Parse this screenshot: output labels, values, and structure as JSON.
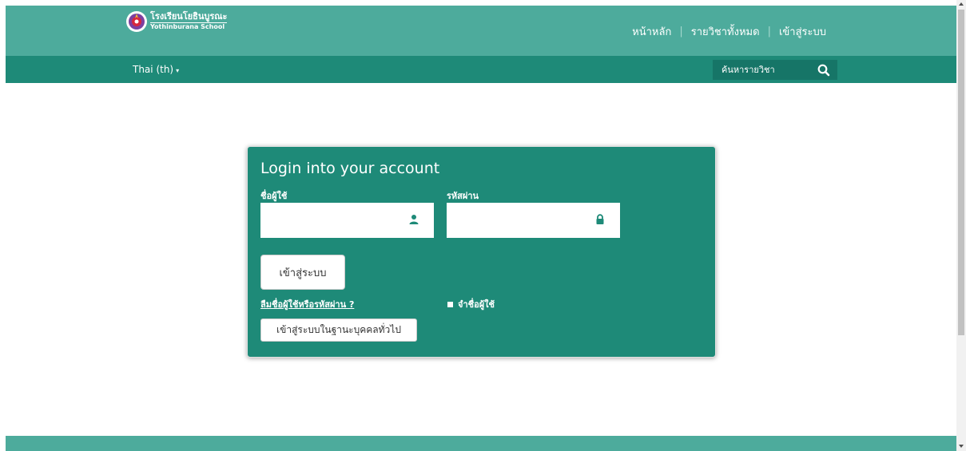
{
  "header": {
    "logo": {
      "thai_name": "โรงเรียนโยธินบูรณะ",
      "english_name": "Yothinburana School"
    },
    "nav": [
      {
        "label": "หน้าหลัก"
      },
      {
        "label": "รายวิชาทั้งหมด"
      },
      {
        "label": "เข้าสู่ระบบ"
      }
    ],
    "separator": "|"
  },
  "subheader": {
    "language": {
      "label": "Thai (th)",
      "caret": "▾"
    },
    "search": {
      "placeholder": "ค้นหารายวิชา",
      "icon": "search-icon"
    }
  },
  "login": {
    "title": "Login into your account",
    "username": {
      "label": "ชื่อผู้ใช้",
      "value": "",
      "icon": "user-icon"
    },
    "password": {
      "label": "รหัสผ่าน",
      "value": "",
      "icon": "lock-icon"
    },
    "submit_label": "เข้าสู่ระบบ",
    "forgot_label": "ลืมชื่อผู้ใช้หรือรหัสผ่าน ?",
    "remember_label": "จำชื่อผู้ใช้",
    "guest_label": "เข้าสู่ระบบในฐานะบุคคลทั่วไป"
  },
  "colors": {
    "topbar": "#4dab9c",
    "subbar": "#1e8a78",
    "card": "#1e8a78",
    "search_box": "#167567"
  }
}
